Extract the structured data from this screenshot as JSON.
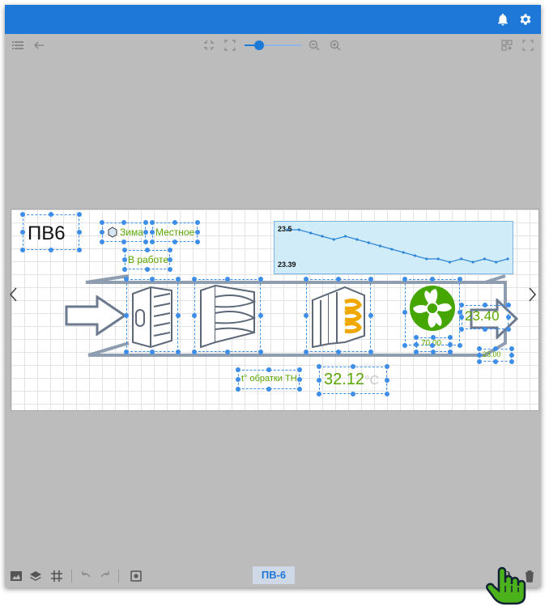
{
  "app": {
    "accent": "#1e78d7",
    "background": "#bcbcbc"
  },
  "header": {
    "icons": [
      "bell-icon",
      "gear-icon"
    ]
  },
  "toolbar": {
    "left_icons": [
      "menu-icon",
      "back-arrow-icon"
    ],
    "zoom_icons": [
      "fit-icon",
      "expand-icon",
      "zoom-out-icon",
      "zoom-in-icon"
    ],
    "right_icons": [
      "grid-add-icon",
      "fullscreen-icon"
    ],
    "zoom_level": 0.1
  },
  "scheme": {
    "title": "ПВ6",
    "mode_label": "Зима",
    "control_label": "Местное",
    "status_label": "В работе",
    "chart": {
      "top_value": "23.5",
      "bottom_value": "23.39"
    },
    "supply_temp": "23.40",
    "fan_speed": "70.00",
    "supply_setpoint": "23.00",
    "return_label": "t° обратки ТН",
    "return_temp": "32.12",
    "return_unit": "°C"
  },
  "chart_data": {
    "type": "line",
    "title": "",
    "y_labels": [
      "23.5",
      "23.39"
    ],
    "ylim": [
      23.39,
      23.5
    ],
    "values": [
      23.5,
      23.5,
      23.49,
      23.48,
      23.47,
      23.48,
      23.47,
      23.46,
      23.45,
      23.44,
      23.43,
      23.42,
      23.41,
      23.41,
      23.4,
      23.41,
      23.4,
      23.41,
      23.4,
      23.41
    ]
  },
  "bottombar": {
    "left_icons": [
      "image-icon",
      "layers-icon",
      "grid-icon",
      "undo-icon",
      "redo-icon",
      "preview-icon"
    ],
    "tab_label": "ПВ-6",
    "right_icons": [
      "save-icon",
      "delete-icon"
    ]
  }
}
